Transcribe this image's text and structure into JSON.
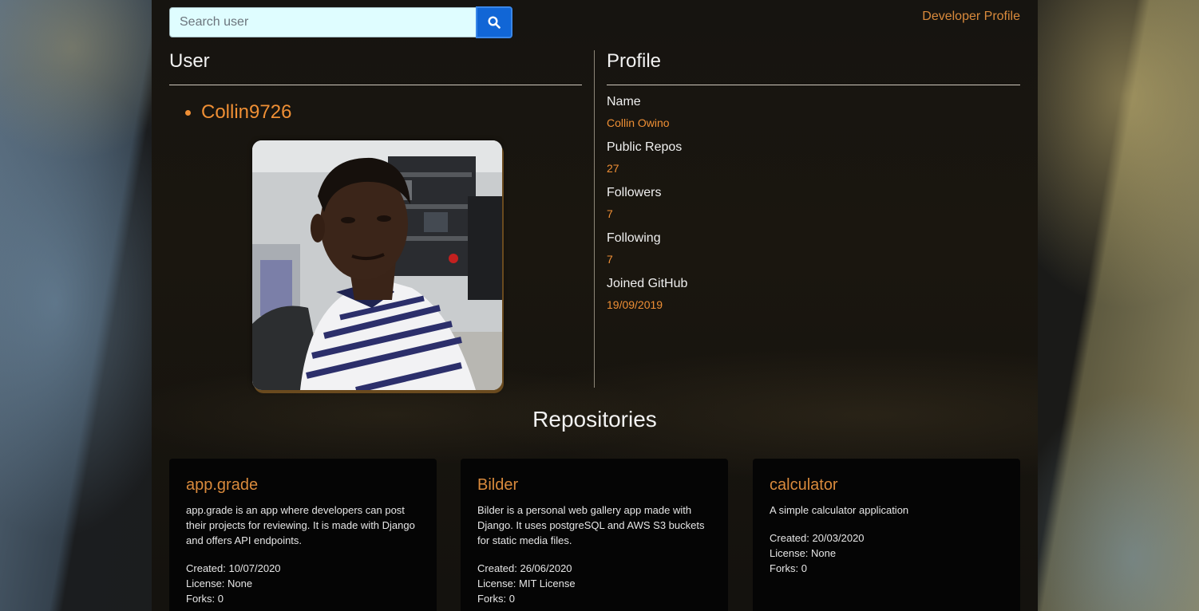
{
  "search": {
    "placeholder": "Search user"
  },
  "nav": {
    "link_label": "Developer Profile"
  },
  "user": {
    "heading": "User",
    "username": "Collin9726"
  },
  "profile": {
    "heading": "Profile",
    "fields": [
      {
        "label": "Name",
        "value": "Collin Owino"
      },
      {
        "label": "Public Repos",
        "value": "27"
      },
      {
        "label": "Followers",
        "value": "7"
      },
      {
        "label": "Following",
        "value": "7"
      },
      {
        "label": "Joined GitHub",
        "value": "19/09/2019"
      }
    ]
  },
  "repos": {
    "heading": "Repositories",
    "items": [
      {
        "name": "app.grade",
        "description": "app.grade is an app where developers can post their projects for reviewing. It is made with Django and offers API endpoints.",
        "created": "Created: 10/07/2020",
        "license": "License: None",
        "forks": "Forks: 0"
      },
      {
        "name": "Bilder",
        "description": "Bilder is a personal web gallery app made with Django. It uses postgreSQL and AWS S3 buckets for static media files.",
        "created": "Created: 26/06/2020",
        "license": "License: MIT License",
        "forks": "Forks: 0"
      },
      {
        "name": "calculator",
        "description": "A simple calculator application",
        "created": "Created: 20/03/2020",
        "license": "License: None",
        "forks": "Forks: 0"
      }
    ]
  },
  "colors": {
    "accent": "#ef8f35",
    "link": "#d98a3c",
    "search_button": "#1166d6",
    "search_field": "#dffdff"
  }
}
